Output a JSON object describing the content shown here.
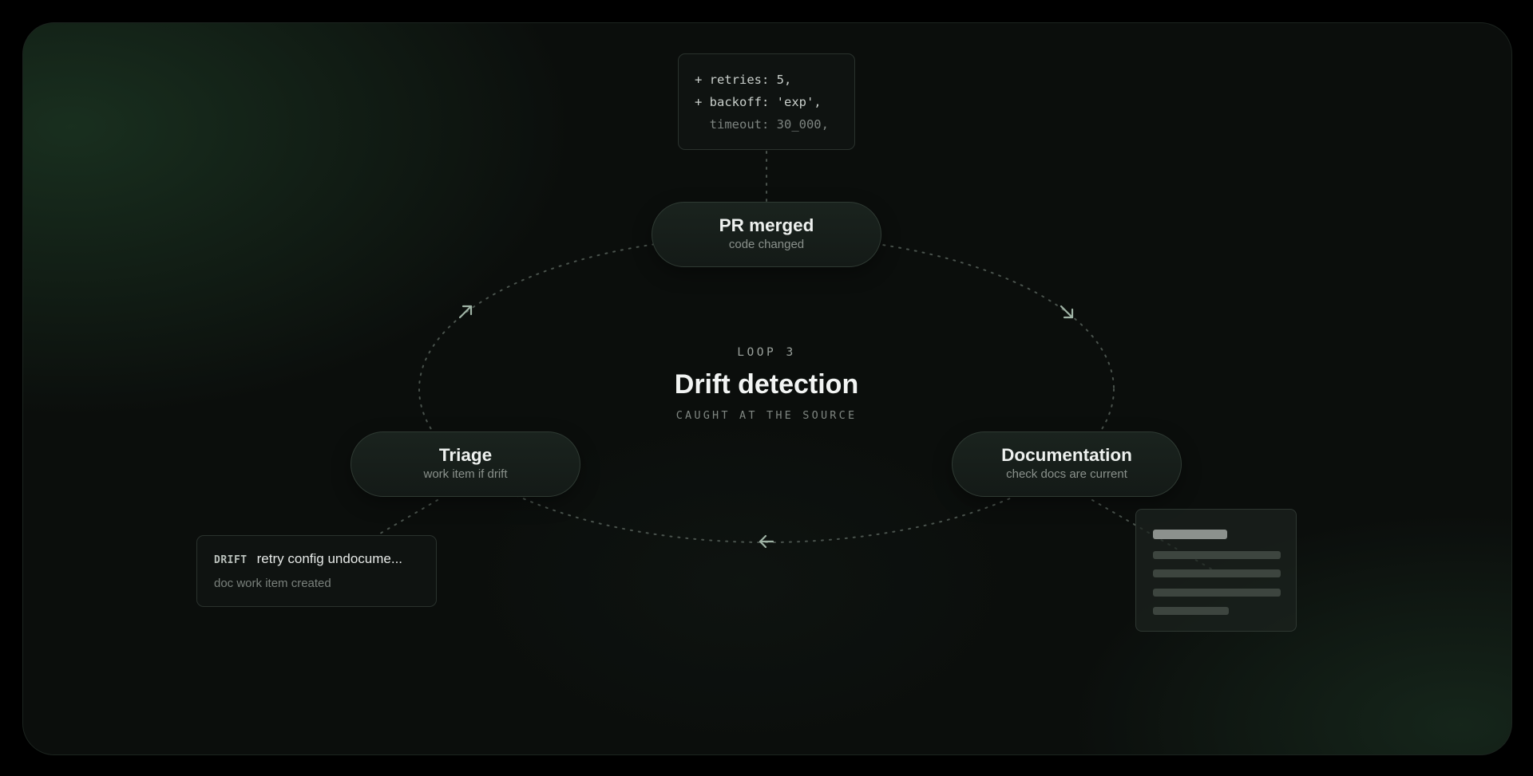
{
  "diagram": {
    "loop_label": "LOOP 3",
    "title": "Drift detection",
    "tagline": "CAUGHT AT THE SOURCE",
    "nodes": [
      {
        "id": "pr",
        "title": "PR merged",
        "subtitle": "code changed"
      },
      {
        "id": "doc",
        "title": "Documentation",
        "subtitle": "check docs are current"
      },
      {
        "id": "triage",
        "title": "Triage",
        "subtitle": "work item if drift"
      }
    ],
    "code_snippet": {
      "lines": [
        {
          "text": "+ retries: 5,",
          "kind": "added"
        },
        {
          "text": "+ backoff: 'exp',",
          "kind": "added"
        },
        {
          "text": "  timeout: 30_000,",
          "kind": "context"
        }
      ]
    },
    "drift_card": {
      "tag": "DRIFT",
      "text": "retry config undocume...",
      "subtitle": "doc work item created"
    },
    "colors": {
      "background": "#0b0e0c",
      "accent_green": "#244a2e",
      "node_fill": "#1a231e",
      "dotted_line": "#4a534d",
      "arrow": "#9fb3a5"
    },
    "icons": [
      "arrow-up-right-icon",
      "arrow-down-right-icon",
      "arrow-left-icon"
    ]
  }
}
